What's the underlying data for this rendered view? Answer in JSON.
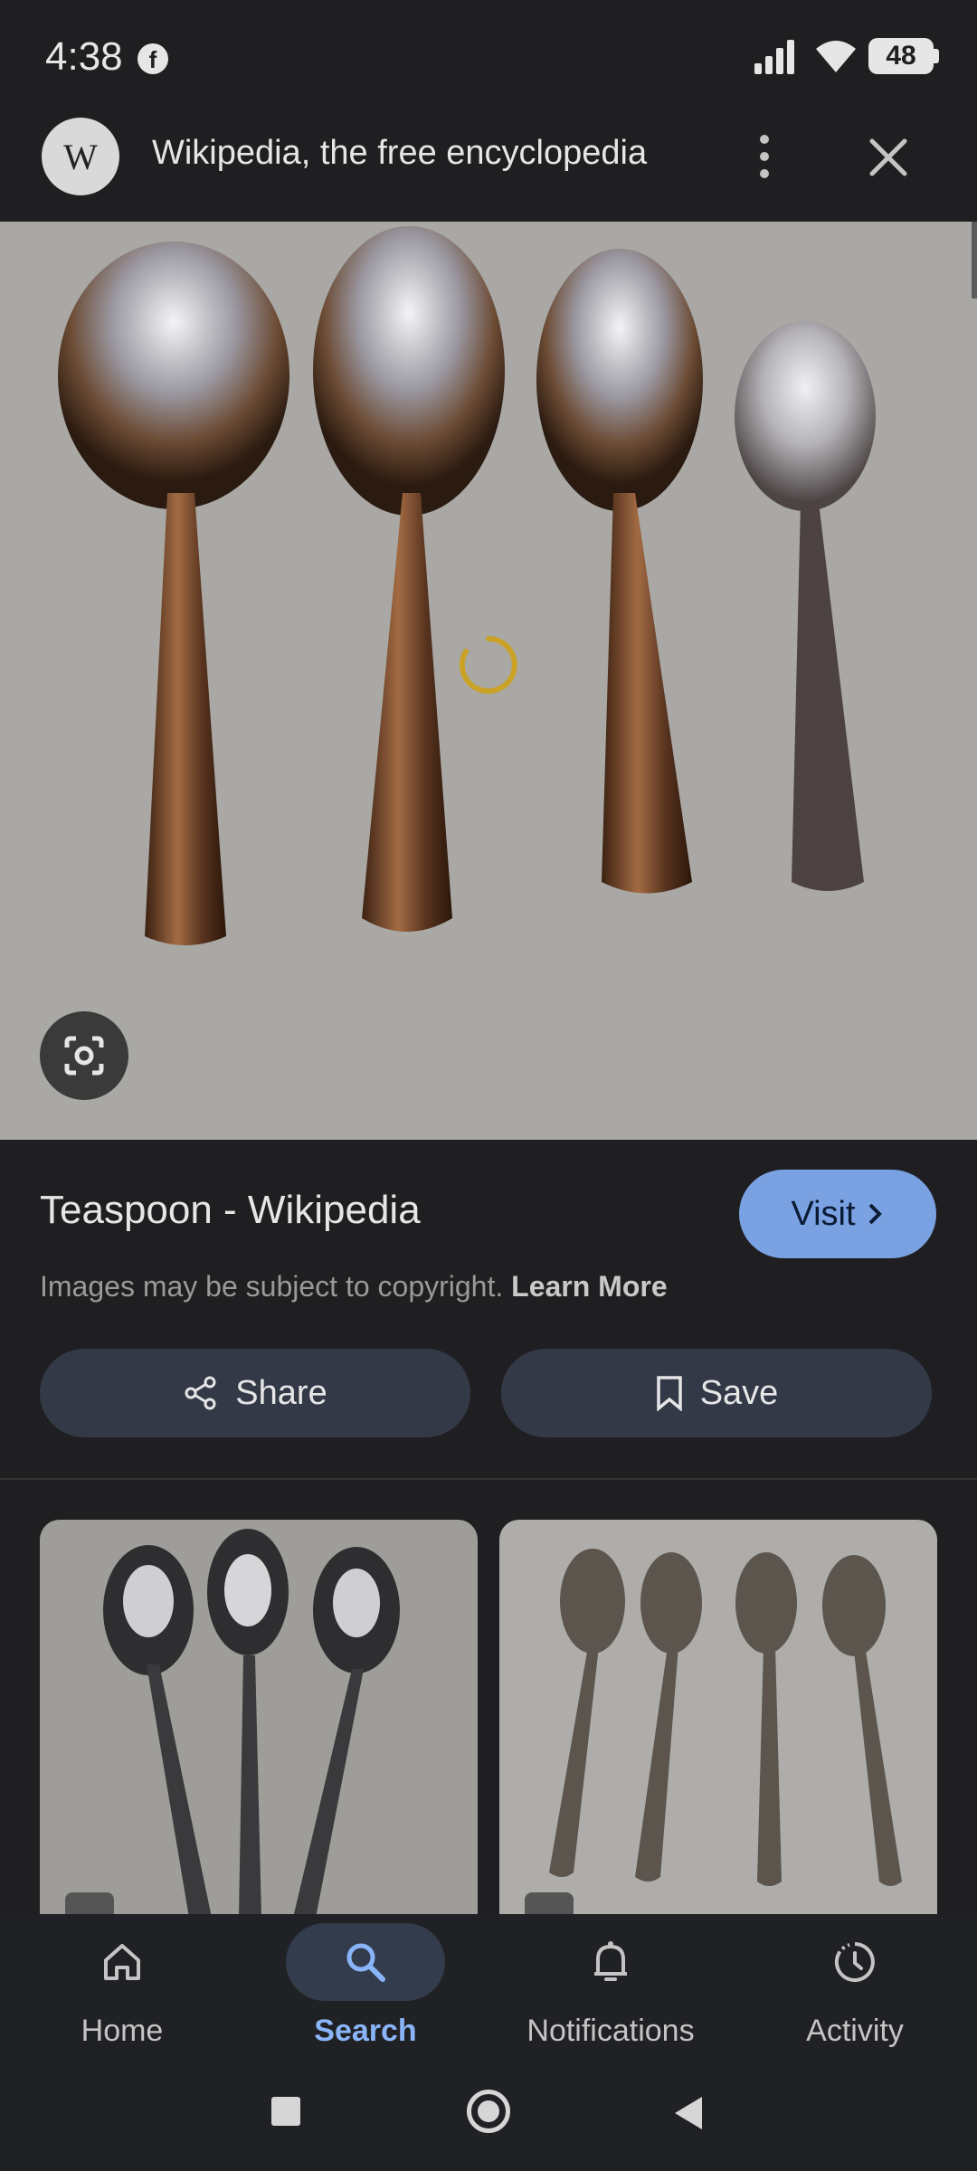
{
  "status_bar": {
    "time": "4:38",
    "battery": "48",
    "notification_icon": "facebook-icon",
    "indicators": [
      "signal-icon",
      "wifi-icon",
      "battery-icon"
    ]
  },
  "source": {
    "avatar_letter": "W",
    "title": "Wikipedia, the free encyclopedia"
  },
  "result": {
    "title": "Teaspoon - Wikipedia",
    "visit_label": "Visit",
    "copyright_text": "Images may be subject to copyright.",
    "learn_more": "Learn More",
    "share_label": "Share",
    "save_label": "Save"
  },
  "bottom_nav": {
    "items": [
      {
        "label": "Home",
        "icon": "home-icon"
      },
      {
        "label": "Search",
        "icon": "search-icon",
        "active": true
      },
      {
        "label": "Notifications",
        "icon": "bell-icon"
      },
      {
        "label": "Activity",
        "icon": "activity-icon"
      }
    ]
  },
  "colors": {
    "background": "#1f1f21",
    "accent": "#7aa2e3",
    "active_nav": "#8ab4f8",
    "button_bg": "#333947",
    "spinner": "#c9a227"
  }
}
